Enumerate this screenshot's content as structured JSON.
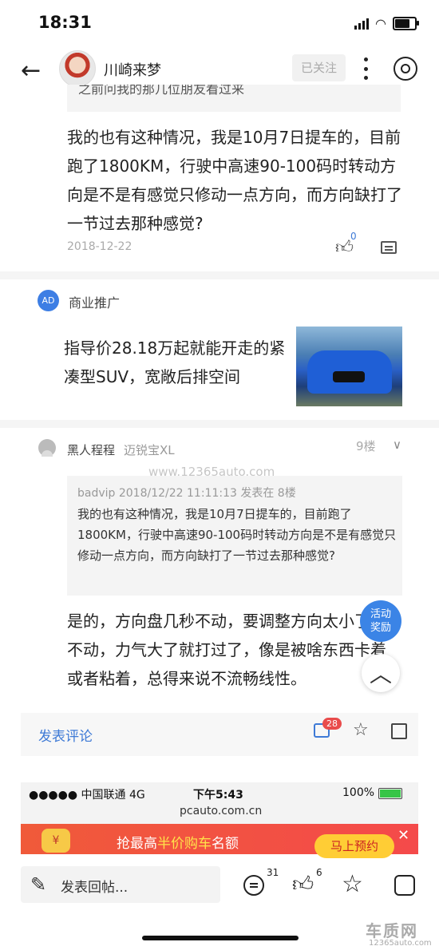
{
  "status_bar": {
    "time": "18:31"
  },
  "header": {
    "username": "川崎来梦",
    "follow_label": "已关注"
  },
  "top_quote": {
    "text": "之前问我的那几位朋友看过来"
  },
  "post1": {
    "text": "我的也有这种情况，我是10月7日提车的，目前跑了1800KM，行驶中高速90-100码时转动方向是不是有感觉只修动一点方向，而方向缺打了一节过去那种感觉?",
    "date": "2018-12-22",
    "like_count": "0"
  },
  "ad": {
    "badge": "AD",
    "label": "商业推广",
    "text": "指导价28.18万起就能开走的紧凑型SUV，宽敞后排空间"
  },
  "post2": {
    "author": "黑人程程",
    "car": "迈锐宝XL",
    "floor": "9楼",
    "quote_meta": "badvip 2018/12/22 11:11:13 发表在 8楼",
    "quote_body": "我的也有这种情况，我是10月7日提车的，目前跑了1800KM，行驶中高速90-100码时转动方向是不是有感觉只修动一点方向，而方向缺打了一节过去那种感觉?",
    "text": "是的，方向盘几秒不动，要调整方向太小了打不动，力气大了就打过了，像是被啥东西卡着或者粘着，总得来说不流畅线性。"
  },
  "watermark": "www.12365auto.com",
  "floating": {
    "reward": "活动奖励"
  },
  "comment_bar": {
    "label": "发表评论",
    "badge": "28"
  },
  "inner_screen": {
    "carrier": "●●●●● 中国联通  4G",
    "time": "下午5:43",
    "battery": "100%",
    "domain": "pcauto.com.cn",
    "promo_pre": "抢最高",
    "promo_hl": "半价购车",
    "promo_post": "名额",
    "promo_button": "马上预约",
    "coin": "¥"
  },
  "bottom_bar": {
    "reply_label": "发表回帖...",
    "comment_count": "31",
    "like_count": "6"
  },
  "brand_watermark": {
    "logo": "车质网",
    "url": "12365auto.com"
  }
}
